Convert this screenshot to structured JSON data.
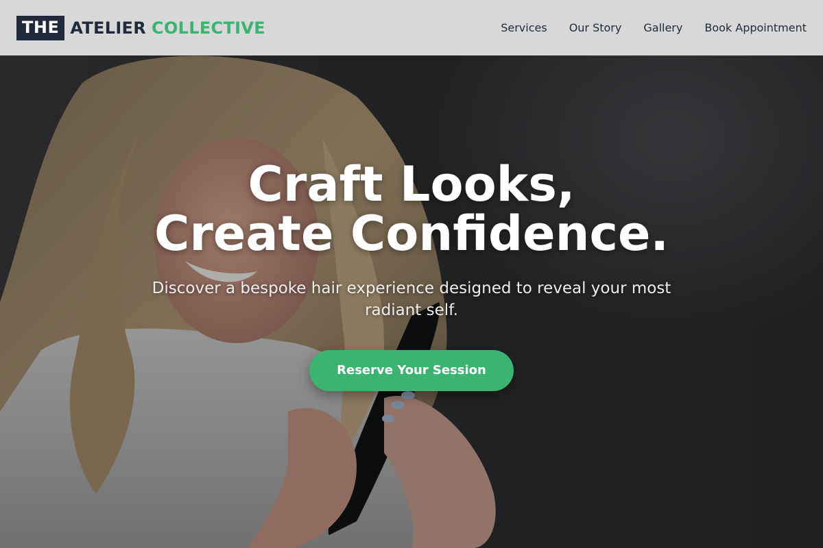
{
  "header": {
    "logo_box": "THE",
    "logo_part1": "ATELIER",
    "logo_part2": "COLLECTIVE",
    "nav": [
      {
        "label": "Services"
      },
      {
        "label": "Our Story"
      },
      {
        "label": "Gallery"
      },
      {
        "label": "Book Appointment"
      }
    ]
  },
  "hero": {
    "headline_line1": "Craft Looks,",
    "headline_line2": "Create Confidence.",
    "subtext": "Discover a bespoke hair experience designed to reveal your most radiant self.",
    "cta_label": "Reserve Your Session"
  },
  "colors": {
    "brand_dark": "#1f2a3c",
    "accent_green": "#3cb371",
    "header_bg": "#d8d8d8"
  }
}
